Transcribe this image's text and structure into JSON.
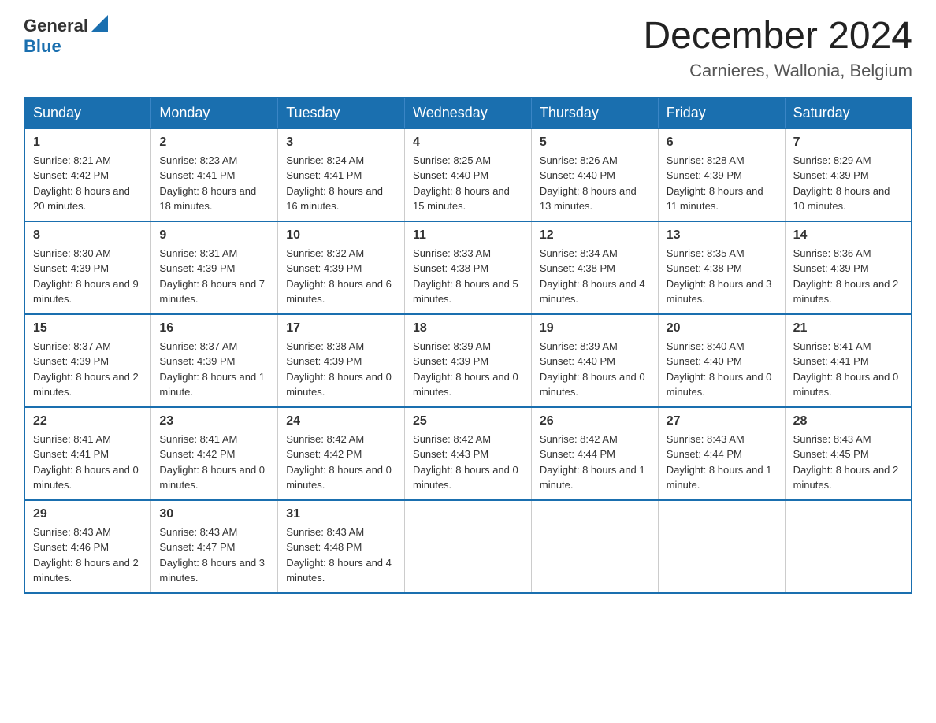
{
  "logo": {
    "general": "General",
    "blue": "Blue"
  },
  "title": "December 2024",
  "location": "Carnieres, Wallonia, Belgium",
  "weekdays": [
    "Sunday",
    "Monday",
    "Tuesday",
    "Wednesday",
    "Thursday",
    "Friday",
    "Saturday"
  ],
  "weeks": [
    [
      {
        "day": "1",
        "sunrise": "8:21 AM",
        "sunset": "4:42 PM",
        "daylight": "8 hours and 20 minutes."
      },
      {
        "day": "2",
        "sunrise": "8:23 AM",
        "sunset": "4:41 PM",
        "daylight": "8 hours and 18 minutes."
      },
      {
        "day": "3",
        "sunrise": "8:24 AM",
        "sunset": "4:41 PM",
        "daylight": "8 hours and 16 minutes."
      },
      {
        "day": "4",
        "sunrise": "8:25 AM",
        "sunset": "4:40 PM",
        "daylight": "8 hours and 15 minutes."
      },
      {
        "day": "5",
        "sunrise": "8:26 AM",
        "sunset": "4:40 PM",
        "daylight": "8 hours and 13 minutes."
      },
      {
        "day": "6",
        "sunrise": "8:28 AM",
        "sunset": "4:39 PM",
        "daylight": "8 hours and 11 minutes."
      },
      {
        "day": "7",
        "sunrise": "8:29 AM",
        "sunset": "4:39 PM",
        "daylight": "8 hours and 10 minutes."
      }
    ],
    [
      {
        "day": "8",
        "sunrise": "8:30 AM",
        "sunset": "4:39 PM",
        "daylight": "8 hours and 9 minutes."
      },
      {
        "day": "9",
        "sunrise": "8:31 AM",
        "sunset": "4:39 PM",
        "daylight": "8 hours and 7 minutes."
      },
      {
        "day": "10",
        "sunrise": "8:32 AM",
        "sunset": "4:39 PM",
        "daylight": "8 hours and 6 minutes."
      },
      {
        "day": "11",
        "sunrise": "8:33 AM",
        "sunset": "4:38 PM",
        "daylight": "8 hours and 5 minutes."
      },
      {
        "day": "12",
        "sunrise": "8:34 AM",
        "sunset": "4:38 PM",
        "daylight": "8 hours and 4 minutes."
      },
      {
        "day": "13",
        "sunrise": "8:35 AM",
        "sunset": "4:38 PM",
        "daylight": "8 hours and 3 minutes."
      },
      {
        "day": "14",
        "sunrise": "8:36 AM",
        "sunset": "4:39 PM",
        "daylight": "8 hours and 2 minutes."
      }
    ],
    [
      {
        "day": "15",
        "sunrise": "8:37 AM",
        "sunset": "4:39 PM",
        "daylight": "8 hours and 2 minutes."
      },
      {
        "day": "16",
        "sunrise": "8:37 AM",
        "sunset": "4:39 PM",
        "daylight": "8 hours and 1 minute."
      },
      {
        "day": "17",
        "sunrise": "8:38 AM",
        "sunset": "4:39 PM",
        "daylight": "8 hours and 0 minutes."
      },
      {
        "day": "18",
        "sunrise": "8:39 AM",
        "sunset": "4:39 PM",
        "daylight": "8 hours and 0 minutes."
      },
      {
        "day": "19",
        "sunrise": "8:39 AM",
        "sunset": "4:40 PM",
        "daylight": "8 hours and 0 minutes."
      },
      {
        "day": "20",
        "sunrise": "8:40 AM",
        "sunset": "4:40 PM",
        "daylight": "8 hours and 0 minutes."
      },
      {
        "day": "21",
        "sunrise": "8:41 AM",
        "sunset": "4:41 PM",
        "daylight": "8 hours and 0 minutes."
      }
    ],
    [
      {
        "day": "22",
        "sunrise": "8:41 AM",
        "sunset": "4:41 PM",
        "daylight": "8 hours and 0 minutes."
      },
      {
        "day": "23",
        "sunrise": "8:41 AM",
        "sunset": "4:42 PM",
        "daylight": "8 hours and 0 minutes."
      },
      {
        "day": "24",
        "sunrise": "8:42 AM",
        "sunset": "4:42 PM",
        "daylight": "8 hours and 0 minutes."
      },
      {
        "day": "25",
        "sunrise": "8:42 AM",
        "sunset": "4:43 PM",
        "daylight": "8 hours and 0 minutes."
      },
      {
        "day": "26",
        "sunrise": "8:42 AM",
        "sunset": "4:44 PM",
        "daylight": "8 hours and 1 minute."
      },
      {
        "day": "27",
        "sunrise": "8:43 AM",
        "sunset": "4:44 PM",
        "daylight": "8 hours and 1 minute."
      },
      {
        "day": "28",
        "sunrise": "8:43 AM",
        "sunset": "4:45 PM",
        "daylight": "8 hours and 2 minutes."
      }
    ],
    [
      {
        "day": "29",
        "sunrise": "8:43 AM",
        "sunset": "4:46 PM",
        "daylight": "8 hours and 2 minutes."
      },
      {
        "day": "30",
        "sunrise": "8:43 AM",
        "sunset": "4:47 PM",
        "daylight": "8 hours and 3 minutes."
      },
      {
        "day": "31",
        "sunrise": "8:43 AM",
        "sunset": "4:48 PM",
        "daylight": "8 hours and 4 minutes."
      },
      null,
      null,
      null,
      null
    ]
  ],
  "labels": {
    "sunrise": "Sunrise:",
    "sunset": "Sunset:",
    "daylight": "Daylight:"
  }
}
